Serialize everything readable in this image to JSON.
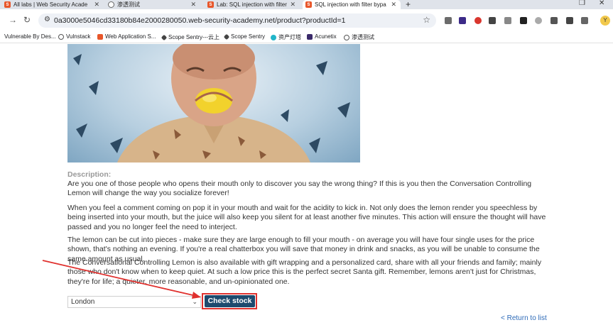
{
  "browser": {
    "tabs": [
      {
        "title": "All labs | Web Security Acade",
        "icon": "portswigger-icon"
      },
      {
        "title": "渗透测试",
        "icon": "globe-icon"
      },
      {
        "title": "Lab: SQL injection with filter",
        "icon": "portswigger-icon"
      },
      {
        "title": "SQL injection with filter bypa",
        "icon": "portswigger-icon",
        "active": true
      }
    ],
    "url": "0a3000e5046cd33180b84e2000280050.web-security-academy.net/product?productId=1",
    "profile_initial": "Y",
    "extension_badge": "2",
    "extension_badge_2": "6"
  },
  "bookmarks": [
    {
      "label": "Vulnerable By Des..."
    },
    {
      "label": "Vulnstack"
    },
    {
      "label": "Web Application S..."
    },
    {
      "label": "Scope Sentry---云上"
    },
    {
      "label": "Scope Sentry"
    },
    {
      "label": "资产灯塔"
    },
    {
      "label": "Acunetix"
    },
    {
      "label": "渗透测试"
    }
  ],
  "product": {
    "description_label": "Description:",
    "paragraphs": [
      "Are you one of those people who opens their mouth only to discover you say the wrong thing? If this is you then the Conversation Controlling Lemon will change the way you socialize forever!",
      "When you feel a comment coming on pop it in your mouth and wait for the acidity to kick in. Not only does the lemon render you speechless by being inserted into your mouth, but the juice will also keep you silent for at least another five minutes. This action will ensure the thought will have passed and you no longer feel the need to interject.",
      "The lemon can be cut into pieces - make sure they are large enough to fill your mouth - on average you will have four single uses for the price shown, that's nothing an evening. If you're a real chatterbox you will save that money in drink and snacks, as you will be unable to consume the same amount as usual.",
      "The Conversational Controlling Lemon is also available with gift wrapping and a personalized card, share with all your friends and family; mainly those who don't know when to keep quiet. At such a low price this is the perfect secret Santa gift. Remember, lemons aren't just for Christmas, they're for life; a quieter, more reasonable, and un-opinionated one."
    ]
  },
  "stock": {
    "selected_store": "London",
    "check_label": "Check stock"
  },
  "return_link": "< Return to list",
  "colors": {
    "button": "#1d4a6e",
    "highlight": "#e0312e",
    "link": "#2e6bb8"
  }
}
